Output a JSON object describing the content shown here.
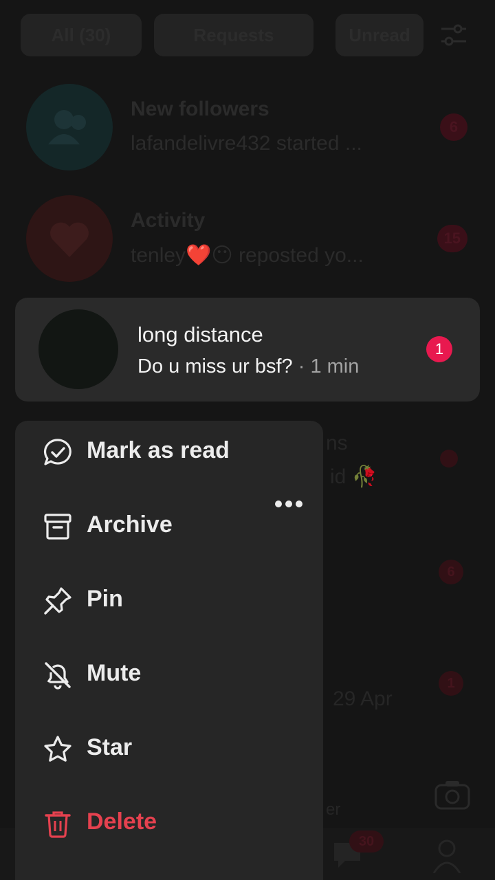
{
  "tabs": {
    "all": "All (30)",
    "requests": "Requests",
    "unread": "Unread"
  },
  "rows": {
    "followers": {
      "title": "New followers",
      "subtitle": "lafandelivre432 started ...",
      "count": "6"
    },
    "activity": {
      "title": "Activity",
      "subtitle": "tenley❤️😶 reposted yo...",
      "count": "15"
    }
  },
  "ghost": {
    "right_text_1": "ns",
    "right_text_2": "id 🥀",
    "date": "29 Apr",
    "badge_2": "6",
    "badge_3": "1",
    "edge_text": "er",
    "nav_count": "30"
  },
  "conversation": {
    "name": "long distance",
    "message": "Do u miss ur bsf?",
    "separator": "·",
    "time": "1 min",
    "unread": "1"
  },
  "menu": {
    "mark_read": "Mark as read",
    "archive": "Archive",
    "pin": "Pin",
    "mute": "Mute",
    "star": "Star",
    "delete": "Delete"
  },
  "colors": {
    "accent_badge": "#e8194f",
    "danger": "#e5414f",
    "menu_bg": "#262626"
  }
}
